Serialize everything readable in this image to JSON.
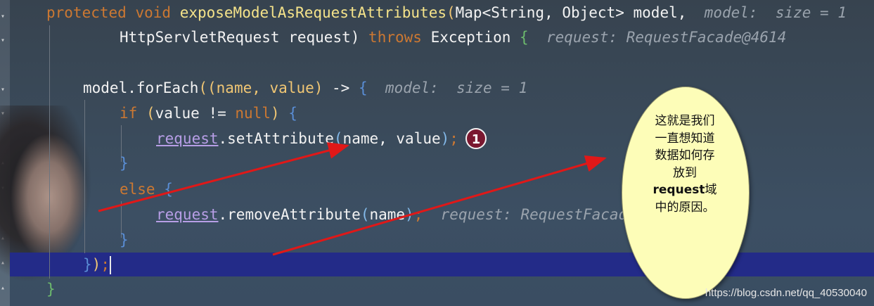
{
  "editor": {
    "line1": {
      "modifier": "protected",
      "return_type": "void",
      "method_name": "exposeModelAsRequestAttributes",
      "param_type": "Map<String, Object>",
      "param_name": "model,",
      "hint": "model:  size = 1"
    },
    "line2": {
      "type": "HttpServletRequest",
      "name": "request)",
      "throws_kw": "throws",
      "exception": "Exception",
      "brace": "{",
      "hint": "request: RequestFacade@4614"
    },
    "line3": {
      "receiver": "model.forEach",
      "args": "((name, value)",
      "arrow": " -> ",
      "brace": "{",
      "hint": "model:  size = 1"
    },
    "line4": {
      "if_kw": "if",
      "cond_open": " (",
      "cond": "value != ",
      "null_kw": "null",
      "cond_close": ")",
      "brace": " {"
    },
    "line5": {
      "field": "request",
      "call": ".setAttribute",
      "args_open": "(",
      "args": "name, value",
      "args_close": ")",
      "semi": ";"
    },
    "line6": {
      "brace": "}"
    },
    "line7": {
      "else_kw": "else",
      "brace": " {"
    },
    "line8": {
      "field": "request",
      "call": ".removeAttribute",
      "args_open": "(",
      "args": "name",
      "args_close": ")",
      "semi": ";",
      "hint": "request: RequestFacad"
    },
    "line9": {
      "brace": "}"
    },
    "line10": {
      "close_brace": "}",
      "close_paren": ")",
      "semi": ";"
    },
    "line11": {
      "brace": "}"
    }
  },
  "annotation": {
    "badge_number": "1",
    "bubble_lines": [
      "这就是我们",
      "一直想知道",
      "数据如何存",
      "放到"
    ],
    "bubble_bold": "request",
    "bubble_bold_suffix": "域",
    "bubble_last": "中的原因。"
  },
  "watermark": "https://blog.csdn.net/qq_40530040",
  "colors": {
    "keyword": "#cc7832",
    "field": "#b79ee6",
    "hint": "#9aa3ad",
    "current_line": "#232b88",
    "arrow": "#e01818",
    "bubble_fill": "#fdfdb8",
    "badge_fill": "#7a1830"
  }
}
